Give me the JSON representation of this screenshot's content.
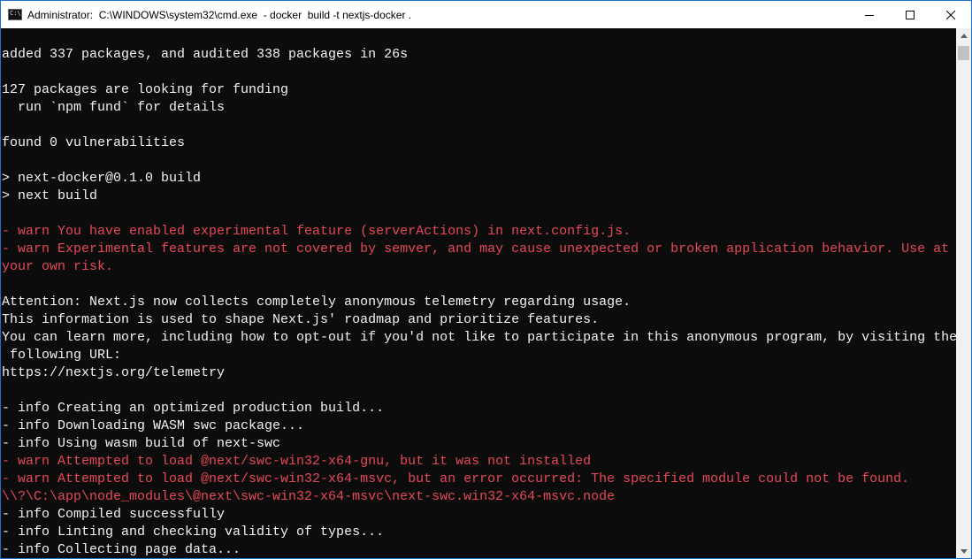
{
  "window": {
    "title": "Administrator:  C:\\WINDOWS\\system32\\cmd.exe  - docker  build -t nextjs-docker .",
    "icon": "cmd-icon",
    "controls": [
      "minimize-icon",
      "maximize-icon",
      "close-icon"
    ]
  },
  "terminal": {
    "lines": [
      {
        "text": "",
        "style": "normal"
      },
      {
        "text": "added 337 packages, and audited 338 packages in 26s",
        "style": "bright"
      },
      {
        "text": "",
        "style": "normal"
      },
      {
        "text": "127 packages are looking for funding",
        "style": "bright"
      },
      {
        "text": "  run `npm fund` for details",
        "style": "bright"
      },
      {
        "text": "",
        "style": "normal"
      },
      {
        "text": "found 0 vulnerabilities",
        "style": "bright"
      },
      {
        "text": "",
        "style": "normal"
      },
      {
        "text": "> next-docker@0.1.0 build",
        "style": "bright"
      },
      {
        "text": "> next build",
        "style": "bright"
      },
      {
        "text": "",
        "style": "normal"
      },
      {
        "text": "- warn You have enabled experimental feature (serverActions) in next.config.js.",
        "style": "warn"
      },
      {
        "text": "- warn Experimental features are not covered by semver, and may cause unexpected or broken application behavior. Use at",
        "style": "warn"
      },
      {
        "text": "your own risk.",
        "style": "warn"
      },
      {
        "text": "",
        "style": "normal"
      },
      {
        "text": "Attention: Next.js now collects completely anonymous telemetry regarding usage.",
        "style": "bright"
      },
      {
        "text": "This information is used to shape Next.js' roadmap and prioritize features.",
        "style": "bright"
      },
      {
        "text": "You can learn more, including how to opt-out if you'd not like to participate in this anonymous program, by visiting the",
        "style": "bright"
      },
      {
        "text": " following URL:",
        "style": "bright"
      },
      {
        "text": "https://nextjs.org/telemetry",
        "style": "bright"
      },
      {
        "text": "",
        "style": "normal"
      },
      {
        "text": "- info Creating an optimized production build...",
        "style": "bright"
      },
      {
        "text": "- info Downloading WASM swc package...",
        "style": "bright"
      },
      {
        "text": "- info Using wasm build of next-swc",
        "style": "bright"
      },
      {
        "text": "- warn Attempted to load @next/swc-win32-x64-gnu, but it was not installed",
        "style": "warn"
      },
      {
        "text": "- warn Attempted to load @next/swc-win32-x64-msvc, but an error occurred: The specified module could not be found.",
        "style": "warn"
      },
      {
        "text": "\\\\?\\C:\\app\\node_modules\\@next\\swc-win32-x64-msvc\\next-swc.win32-x64-msvc.node",
        "style": "warn"
      },
      {
        "text": "- info Compiled successfully",
        "style": "bright"
      },
      {
        "text": "- info Linting and checking validity of types...",
        "style": "bright"
      },
      {
        "text": "- info Collecting page data...",
        "style": "bright"
      }
    ]
  },
  "colors": {
    "background": "#0c0c0c",
    "text": "#f2f2f2",
    "warn": "#e74856",
    "titlebar": "#ffffff",
    "border": "#1a73c9"
  }
}
